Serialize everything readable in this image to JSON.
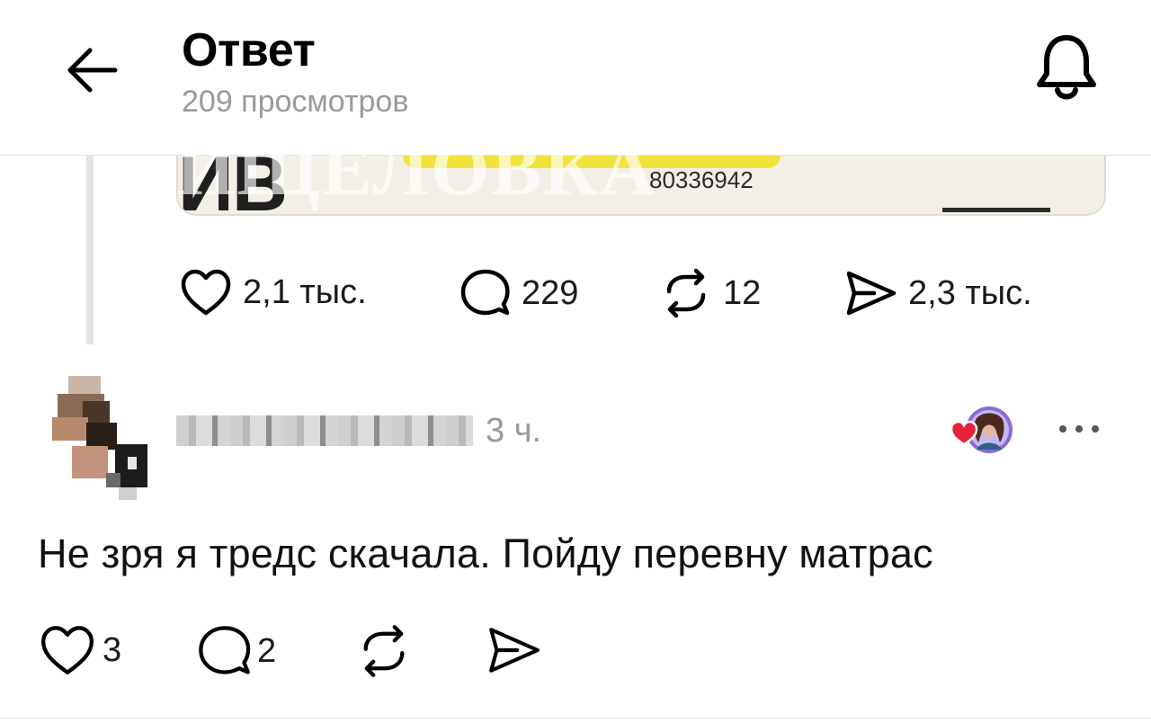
{
  "header": {
    "title": "Ответ",
    "views": "209 просмотров",
    "back_icon": "arrow-left-icon",
    "notifications_icon": "bell-icon"
  },
  "parent_post": {
    "media": {
      "letters": "ИВ",
      "code": "80336942",
      "watermark": "ИЩЕЛОВКА"
    },
    "actions": {
      "likes": "2,1 тыс.",
      "replies": "229",
      "reposts": "12",
      "shares": "2,3 тыс."
    }
  },
  "reply": {
    "time": "3 ч.",
    "text": "Не зря я тредс скачала. Пойду перевну матрас",
    "actions": {
      "likes": "3",
      "replies": "2"
    }
  },
  "colors": {
    "text": "#000000",
    "muted": "#9a9a9a",
    "divider": "#e6e6e6",
    "heart_badge": "#e8213a",
    "avatar_ring": "#8a6bd6"
  }
}
